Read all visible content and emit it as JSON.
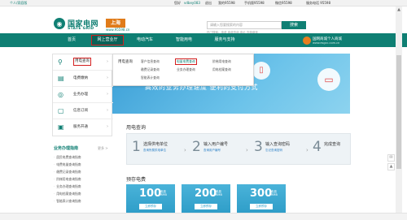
{
  "topbar": {
    "personal": "个人/家庭版",
    "welcome": "您好",
    "user": "vdbey083",
    "logout": "退出",
    "mail": "我的95598",
    "mobile": "手机版95598",
    "wechat": "微信95598",
    "phone": "服务电话 95598"
  },
  "header": {
    "logo_cn": "国家电网",
    "logo_en": "STATE GRID",
    "city": "上海",
    "domain": "www.95598.cn",
    "search_placeholder": "请输入您要搜索的内容",
    "search_button": "搜索",
    "hot": "热门搜索：电费 电费查询 电价 充值缴费"
  },
  "nav": {
    "items": [
      {
        "label": "首页"
      },
      {
        "label": "网上营业厅"
      },
      {
        "label": "电动汽车"
      },
      {
        "label": "智能用电"
      },
      {
        "label": "服务与支持"
      }
    ],
    "promo_title": "国网商城个人商城",
    "promo_sub": "www.esgcc.com.cn"
  },
  "sidebar": {
    "items": [
      {
        "label": "用电查询",
        "icon": "magnifier-icon"
      },
      {
        "label": "电费缴纳",
        "icon": "payment-icon"
      },
      {
        "label": "业务办理",
        "icon": "service-icon"
      },
      {
        "label": "信息订阅",
        "icon": "subscribe-icon"
      },
      {
        "label": "服务开通",
        "icon": "open-service-icon"
      }
    ]
  },
  "dropdown": {
    "col_title": "用电查询",
    "links": [
      "客户信息查询",
      "电量电费查询",
      "阶梯用电查询",
      "缴费记录查询",
      "业务办理查询",
      "用电档案查询",
      "智能表计查询"
    ]
  },
  "banner": {
    "text": "高效的业务办理速度  便利的支付方式",
    "colors": {
      "from": "#3a9ed6",
      "to": "#8dd3ef"
    }
  },
  "query_section": {
    "title": "用电查询",
    "steps": [
      {
        "num": "1",
        "title": "选择供电单位",
        "sub": "查询所属供电单位"
      },
      {
        "num": "2",
        "title": "输入用户编号",
        "sub": "查询用户编号"
      },
      {
        "num": "3",
        "title": "输入查询密码",
        "sub": "忘记查询密码"
      },
      {
        "num": "4",
        "title": "完成查询",
        "sub": ""
      }
    ]
  },
  "business_guide": {
    "title": "业务办理指南",
    "more": "更多 >",
    "items": [
      "居民电费查询指南",
      "电费电量查询指南",
      "缴费记录查询指南",
      "阶梯用电查询指南",
      "业务办理查询指南",
      "用电档案查询指南",
      "智能表计查询指南"
    ]
  },
  "prepaid_section": {
    "title": "预存电费",
    "cards": [
      {
        "amount": "100",
        "unit_top": "电费",
        "unit_bottom": "RMB",
        "button": "立即预存"
      },
      {
        "amount": "200",
        "unit_top": "电费",
        "unit_bottom": "RMB",
        "button": "立即预存"
      },
      {
        "amount": "300",
        "unit_top": "电费",
        "unit_bottom": "RMB",
        "button": "立即预存"
      }
    ]
  },
  "colors": {
    "brand": "#0f7f73",
    "accent": "#e07b1a",
    "highlight": "#d31f1f"
  }
}
